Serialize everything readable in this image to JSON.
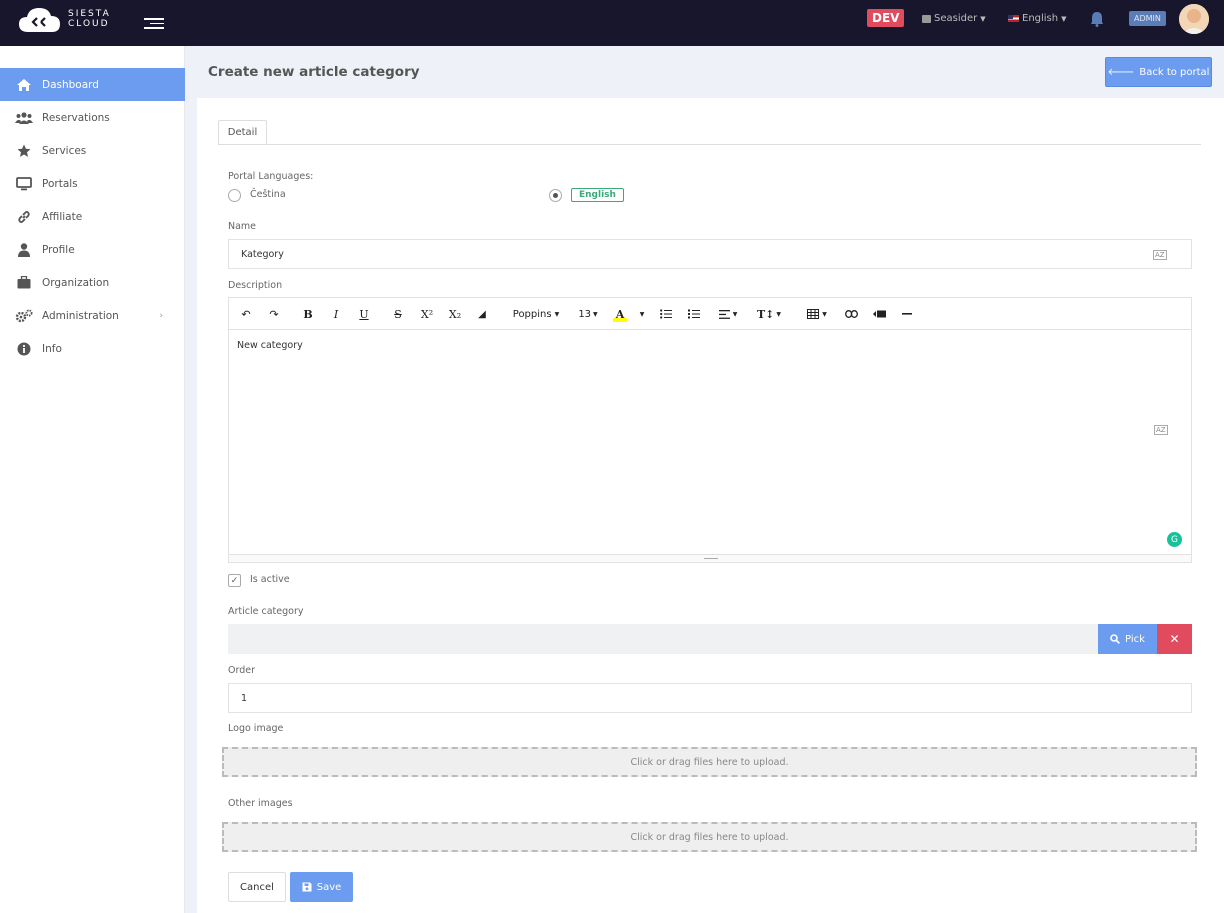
{
  "header": {
    "logo_line1": "SIESTA",
    "logo_line2": "CLOUD",
    "env_badge": "DEV",
    "organization": "Seasider",
    "language": "English",
    "role_badge": "ADMIN"
  },
  "sidebar": {
    "items": [
      {
        "label": "Dashboard",
        "icon": "home-icon",
        "active": true
      },
      {
        "label": "Reservations",
        "icon": "users-icon"
      },
      {
        "label": "Services",
        "icon": "star-icon"
      },
      {
        "label": "Portals",
        "icon": "monitor-icon"
      },
      {
        "label": "Affiliate",
        "icon": "link-icon"
      },
      {
        "label": "Profile",
        "icon": "user-icon"
      },
      {
        "label": "Organization",
        "icon": "briefcase-icon"
      },
      {
        "label": "Administration",
        "icon": "cogs-icon",
        "has_submenu": true
      },
      {
        "label": "Info",
        "icon": "info-icon"
      }
    ]
  },
  "page": {
    "title": "Create new article category",
    "back_button": "Back to portal"
  },
  "form": {
    "tab_detail": "Detail",
    "portal_languages_label": "Portal Languages:",
    "lang_cz": "Čeština",
    "lang_en": "English",
    "name_label": "Name",
    "name_value": "Kategory",
    "translate_icon": "AZ",
    "description_label": "Description",
    "editor": {
      "font": "Poppins",
      "font_size": "13",
      "content": "New category"
    },
    "is_active_label": "Is active",
    "is_active": true,
    "article_category_label": "Article category",
    "article_category_value": "",
    "pick_button": "Pick",
    "order_label": "Order",
    "order_value": "1",
    "logo_image_label": "Logo image",
    "upload_text": "Click or drag files here to upload.",
    "other_images_label": "Other images",
    "cancel_button": "Cancel",
    "save_button": "Save"
  },
  "colors": {
    "topbar": "#18162c",
    "accent": "#6b9cf0",
    "danger": "#e04b5e",
    "success": "#3aa87a"
  }
}
